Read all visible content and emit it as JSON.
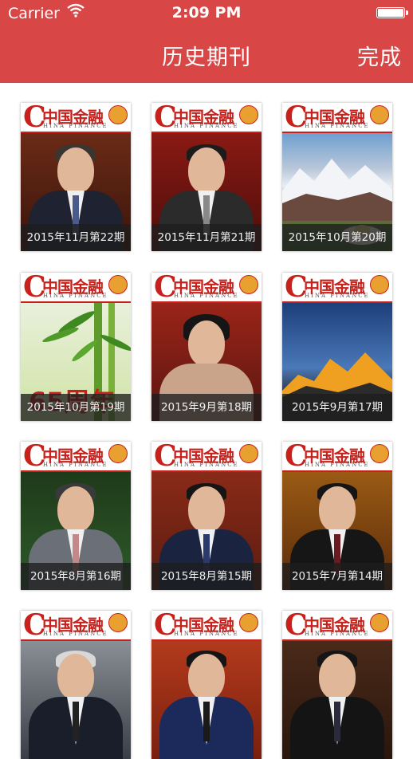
{
  "status_bar": {
    "carrier": "Carrier",
    "time": "2:09 PM",
    "wifi_icon": "wifi-icon",
    "battery_icon": "battery-icon"
  },
  "nav": {
    "title": "历史期刊",
    "done_label": "完成",
    "background": "#d94646"
  },
  "masthead": {
    "title_c": "C",
    "title_zh": "中国金融",
    "title_en": "HINA FINANCE",
    "brand_color": "#c8201b"
  },
  "issues": [
    {
      "label": "2015年11月第22期"
    },
    {
      "label": "2015年11月第21期"
    },
    {
      "label": "2015年10月第20期"
    },
    {
      "label": "2015年10月第19期",
      "cover_text": "65周年"
    },
    {
      "label": "2015年9月第18期"
    },
    {
      "label": "2015年9月第17期"
    },
    {
      "label": "2015年8月第16期"
    },
    {
      "label": "2015年8月第15期"
    },
    {
      "label": "2015年7月第14期"
    },
    {
      "label": ""
    },
    {
      "label": ""
    },
    {
      "label": ""
    }
  ]
}
